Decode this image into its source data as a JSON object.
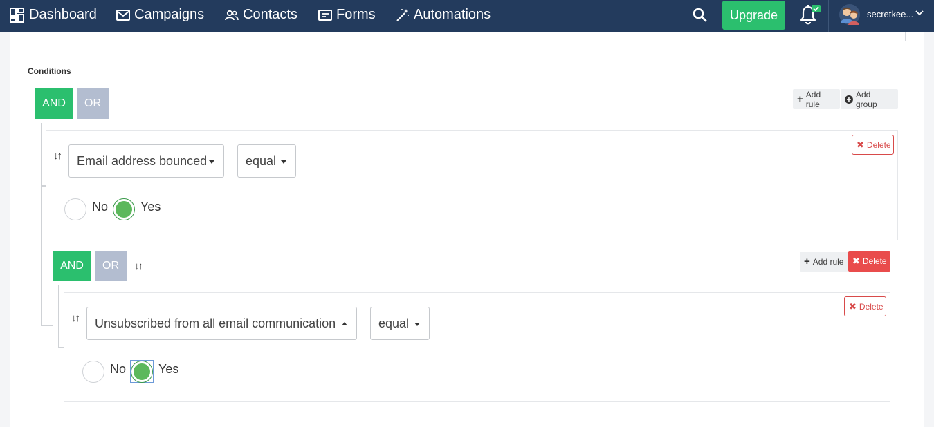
{
  "nav": {
    "items": [
      {
        "label": "Dashboard",
        "icon": "dashboard-icon"
      },
      {
        "label": "Campaigns",
        "icon": "envelope-icon"
      },
      {
        "label": "Contacts",
        "icon": "users-icon"
      },
      {
        "label": "Forms",
        "icon": "form-icon"
      },
      {
        "label": "Automations",
        "icon": "magic-wand-icon"
      }
    ],
    "upgrade_label": "Upgrade",
    "user_name": "secretkee..."
  },
  "conditions": {
    "label": "Conditions",
    "and_label": "AND",
    "or_label": "OR",
    "add_rule_label": "Add rule",
    "add_group_label": "Add group",
    "delete_label": "Delete",
    "rule1": {
      "field": "Email address bounced",
      "operator": "equal",
      "option_no": "No",
      "option_yes": "Yes",
      "selected": "Yes"
    },
    "group2": {
      "and_label": "AND",
      "or_label": "OR",
      "add_rule_label": "Add rule",
      "delete_label": "Delete",
      "rule1": {
        "field": "Unsubscribed from all email communication",
        "operator": "equal",
        "option_no": "No",
        "option_yes": "Yes",
        "selected": "Yes"
      }
    }
  },
  "colors": {
    "navbar": "#233b5d",
    "green": "#2bbf6e",
    "or_gray": "#b3bdd0",
    "delete_red": "#e94c4c"
  }
}
